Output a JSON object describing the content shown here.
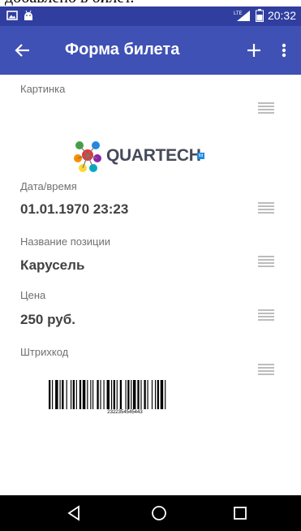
{
  "caption": {
    "text": "добавлено в билет."
  },
  "status_bar": {
    "network": "LTE",
    "time": "20:32"
  },
  "app_bar": {
    "title": "Форма билета"
  },
  "fields": {
    "picture": {
      "label": "Картинка"
    },
    "datetime": {
      "label": "Дата/время",
      "value": "01.01.1970 23:23"
    },
    "item_name": {
      "label": "Название позиции",
      "value": "Карусель"
    },
    "price": {
      "label": "Цена",
      "value": "250 руб."
    },
    "barcode": {
      "label": "Штрихкод",
      "number": "2322354545443"
    }
  },
  "logo": {
    "text": "QUARTECH",
    "badge": "ltd"
  },
  "colors": {
    "status_bar": "#303f9f",
    "app_bar": "#3f51b5",
    "label": "#707070",
    "value": "#424242",
    "handle": "#bdbdbd"
  },
  "icons": [
    "photo-icon",
    "android-icon",
    "lte-signal-icon",
    "battery-icon",
    "back-arrow-icon",
    "add-icon",
    "more-vert-icon",
    "drag-handle-icon",
    "nav-back-icon",
    "nav-home-icon",
    "nav-recents-icon"
  ]
}
